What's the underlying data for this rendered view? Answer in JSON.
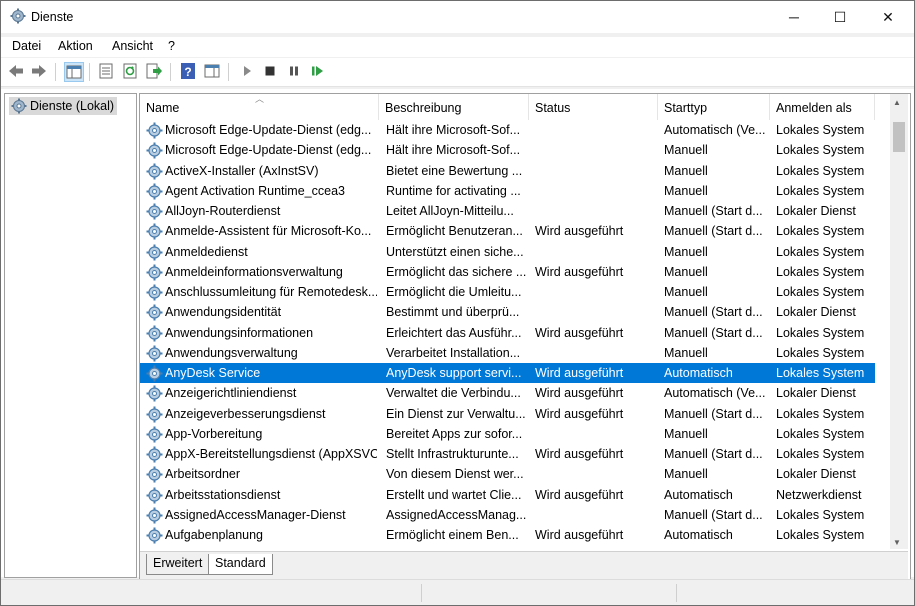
{
  "window": {
    "title": "Dienste",
    "icon": "gear-icon"
  },
  "window_controls": {
    "minimize": "─",
    "maximize": "☐",
    "close": "✕"
  },
  "menu": [
    "Datei",
    "Aktion",
    "Ansicht",
    "?"
  ],
  "tree": {
    "item": "Dienste (Lokal)"
  },
  "columns": {
    "name": "Name",
    "description": "Beschreibung",
    "status": "Status",
    "startup": "Starttyp",
    "logon": "Anmelden als"
  },
  "services": [
    {
      "name": "Microsoft Edge-Update-Dienst (edg...",
      "desc": "Hält ihre Microsoft-Sof...",
      "status": "",
      "startup": "Automatisch (Ve...",
      "logon": "Lokales System"
    },
    {
      "name": "Microsoft Edge-Update-Dienst (edg...",
      "desc": "Hält ihre Microsoft-Sof...",
      "status": "",
      "startup": "Manuell",
      "logon": "Lokales System"
    },
    {
      "name": "ActiveX-Installer (AxInstSV)",
      "desc": "Bietet eine Bewertung ...",
      "status": "",
      "startup": "Manuell",
      "logon": "Lokales System"
    },
    {
      "name": "Agent Activation Runtime_ccea3",
      "desc": "Runtime for activating ...",
      "status": "",
      "startup": "Manuell",
      "logon": "Lokales System"
    },
    {
      "name": "AllJoyn-Routerdienst",
      "desc": "Leitet AllJoyn-Mitteilu...",
      "status": "",
      "startup": "Manuell (Start d...",
      "logon": "Lokaler Dienst"
    },
    {
      "name": "Anmelde-Assistent für Microsoft-Ko...",
      "desc": "Ermöglicht Benutzeran...",
      "status": "Wird ausgeführt",
      "startup": "Manuell (Start d...",
      "logon": "Lokales System"
    },
    {
      "name": "Anmeldedienst",
      "desc": "Unterstützt einen siche...",
      "status": "",
      "startup": "Manuell",
      "logon": "Lokales System"
    },
    {
      "name": "Anmeldeinformationsverwaltung",
      "desc": "Ermöglicht das sichere ...",
      "status": "Wird ausgeführt",
      "startup": "Manuell",
      "logon": "Lokales System"
    },
    {
      "name": "Anschlussumleitung für Remotedesk...",
      "desc": "Ermöglicht die Umleitu...",
      "status": "",
      "startup": "Manuell",
      "logon": "Lokales System"
    },
    {
      "name": "Anwendungsidentität",
      "desc": "Bestimmt und überprü...",
      "status": "",
      "startup": "Manuell (Start d...",
      "logon": "Lokaler Dienst"
    },
    {
      "name": "Anwendungsinformationen",
      "desc": "Erleichtert das Ausführ...",
      "status": "Wird ausgeführt",
      "startup": "Manuell (Start d...",
      "logon": "Lokales System"
    },
    {
      "name": "Anwendungsverwaltung",
      "desc": "Verarbeitet Installation...",
      "status": "",
      "startup": "Manuell",
      "logon": "Lokales System"
    },
    {
      "name": "AnyDesk Service",
      "desc": "AnyDesk support servi...",
      "status": "Wird ausgeführt",
      "startup": "Automatisch",
      "logon": "Lokales System",
      "selected": true
    },
    {
      "name": "Anzeigerichtliniendienst",
      "desc": "Verwaltet die Verbindu...",
      "status": "Wird ausgeführt",
      "startup": "Automatisch (Ve...",
      "logon": "Lokaler Dienst"
    },
    {
      "name": "Anzeigeverbesserungsdienst",
      "desc": "Ein Dienst zur Verwaltu...",
      "status": "Wird ausgeführt",
      "startup": "Manuell (Start d...",
      "logon": "Lokales System"
    },
    {
      "name": "App-Vorbereitung",
      "desc": "Bereitet Apps zur sofor...",
      "status": "",
      "startup": "Manuell",
      "logon": "Lokales System"
    },
    {
      "name": "AppX-Bereitstellungsdienst (AppXSVC)",
      "desc": "Stellt Infrastrukturunte...",
      "status": "Wird ausgeführt",
      "startup": "Manuell (Start d...",
      "logon": "Lokales System"
    },
    {
      "name": "Arbeitsordner",
      "desc": "Von diesem Dienst wer...",
      "status": "",
      "startup": "Manuell",
      "logon": "Lokaler Dienst"
    },
    {
      "name": "Arbeitsstationsdienst",
      "desc": "Erstellt und wartet Clie...",
      "status": "Wird ausgeführt",
      "startup": "Automatisch",
      "logon": "Netzwerkdienst"
    },
    {
      "name": "AssignedAccessManager-Dienst",
      "desc": "AssignedAccessManag...",
      "status": "",
      "startup": "Manuell (Start d...",
      "logon": "Lokales System"
    },
    {
      "name": "Aufgabenplanung",
      "desc": "Ermöglicht einem Ben...",
      "status": "Wird ausgeführt",
      "startup": "Automatisch",
      "logon": "Lokales System"
    }
  ],
  "tabs": {
    "extended": "Erweitert",
    "standard": "Standard"
  },
  "colors": {
    "selection": "#0078d7",
    "gear": "#4a7fb0"
  }
}
